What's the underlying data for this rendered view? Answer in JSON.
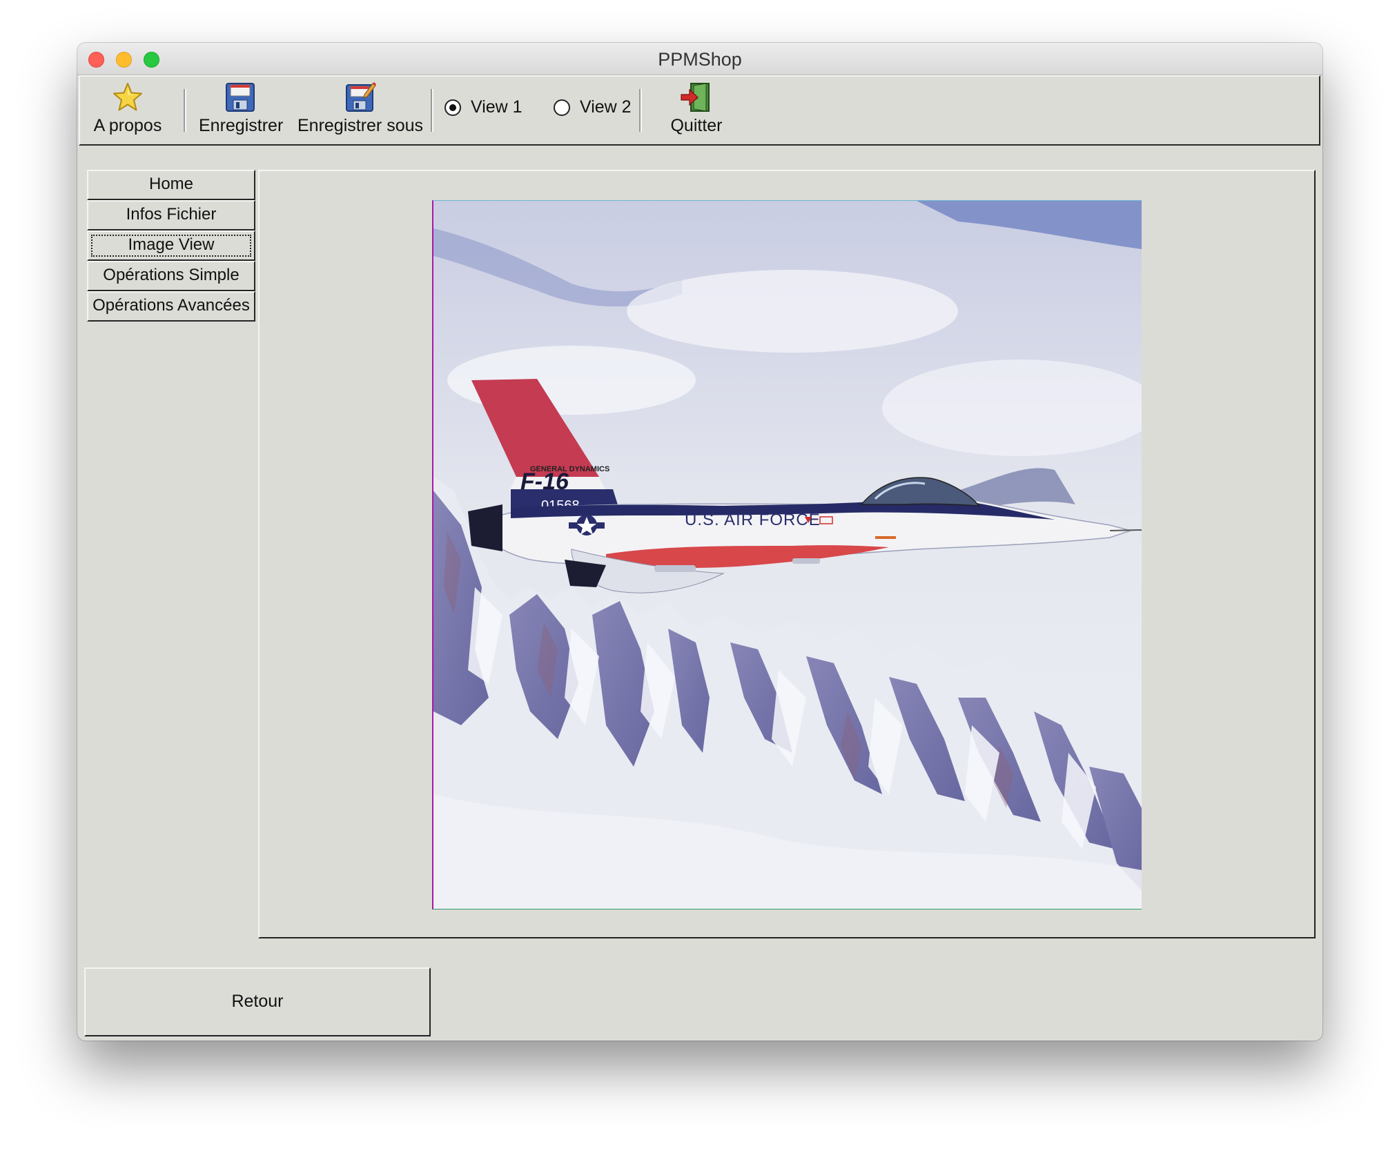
{
  "window": {
    "title": "PPMShop"
  },
  "toolbar": {
    "about": {
      "label": "A propos",
      "icon": "star-icon"
    },
    "save": {
      "label": "Enregistrer",
      "icon": "floppy-disk-icon"
    },
    "save_as": {
      "label": "Enregistrer sous",
      "icon": "floppy-disk-edit-icon"
    },
    "view1": {
      "label": "View 1",
      "selected": true
    },
    "view2": {
      "label": "View 2",
      "selected": false
    },
    "quit": {
      "label": "Quitter",
      "icon": "exit-door-icon"
    }
  },
  "sidebar": {
    "items": [
      {
        "label": "Home",
        "active": false
      },
      {
        "label": "Infos Fichier",
        "active": false
      },
      {
        "label": "Image View",
        "active": true
      },
      {
        "label": "Opérations Simple",
        "active": false
      },
      {
        "label": "Opérations Avancées",
        "active": false
      }
    ]
  },
  "image": {
    "description": "F-16 fighter jet flying over snowy mountains",
    "tail_markings": [
      "GENERAL DYNAMICS",
      "F-16",
      "01568"
    ],
    "fuselage_text": "U.S. AIR FORCE"
  },
  "footer": {
    "back_label": "Retour"
  },
  "colors": {
    "window_bg": "#dcdcd7",
    "close": "#fe5f57",
    "minimize": "#febc2e",
    "maximize": "#28c840"
  }
}
